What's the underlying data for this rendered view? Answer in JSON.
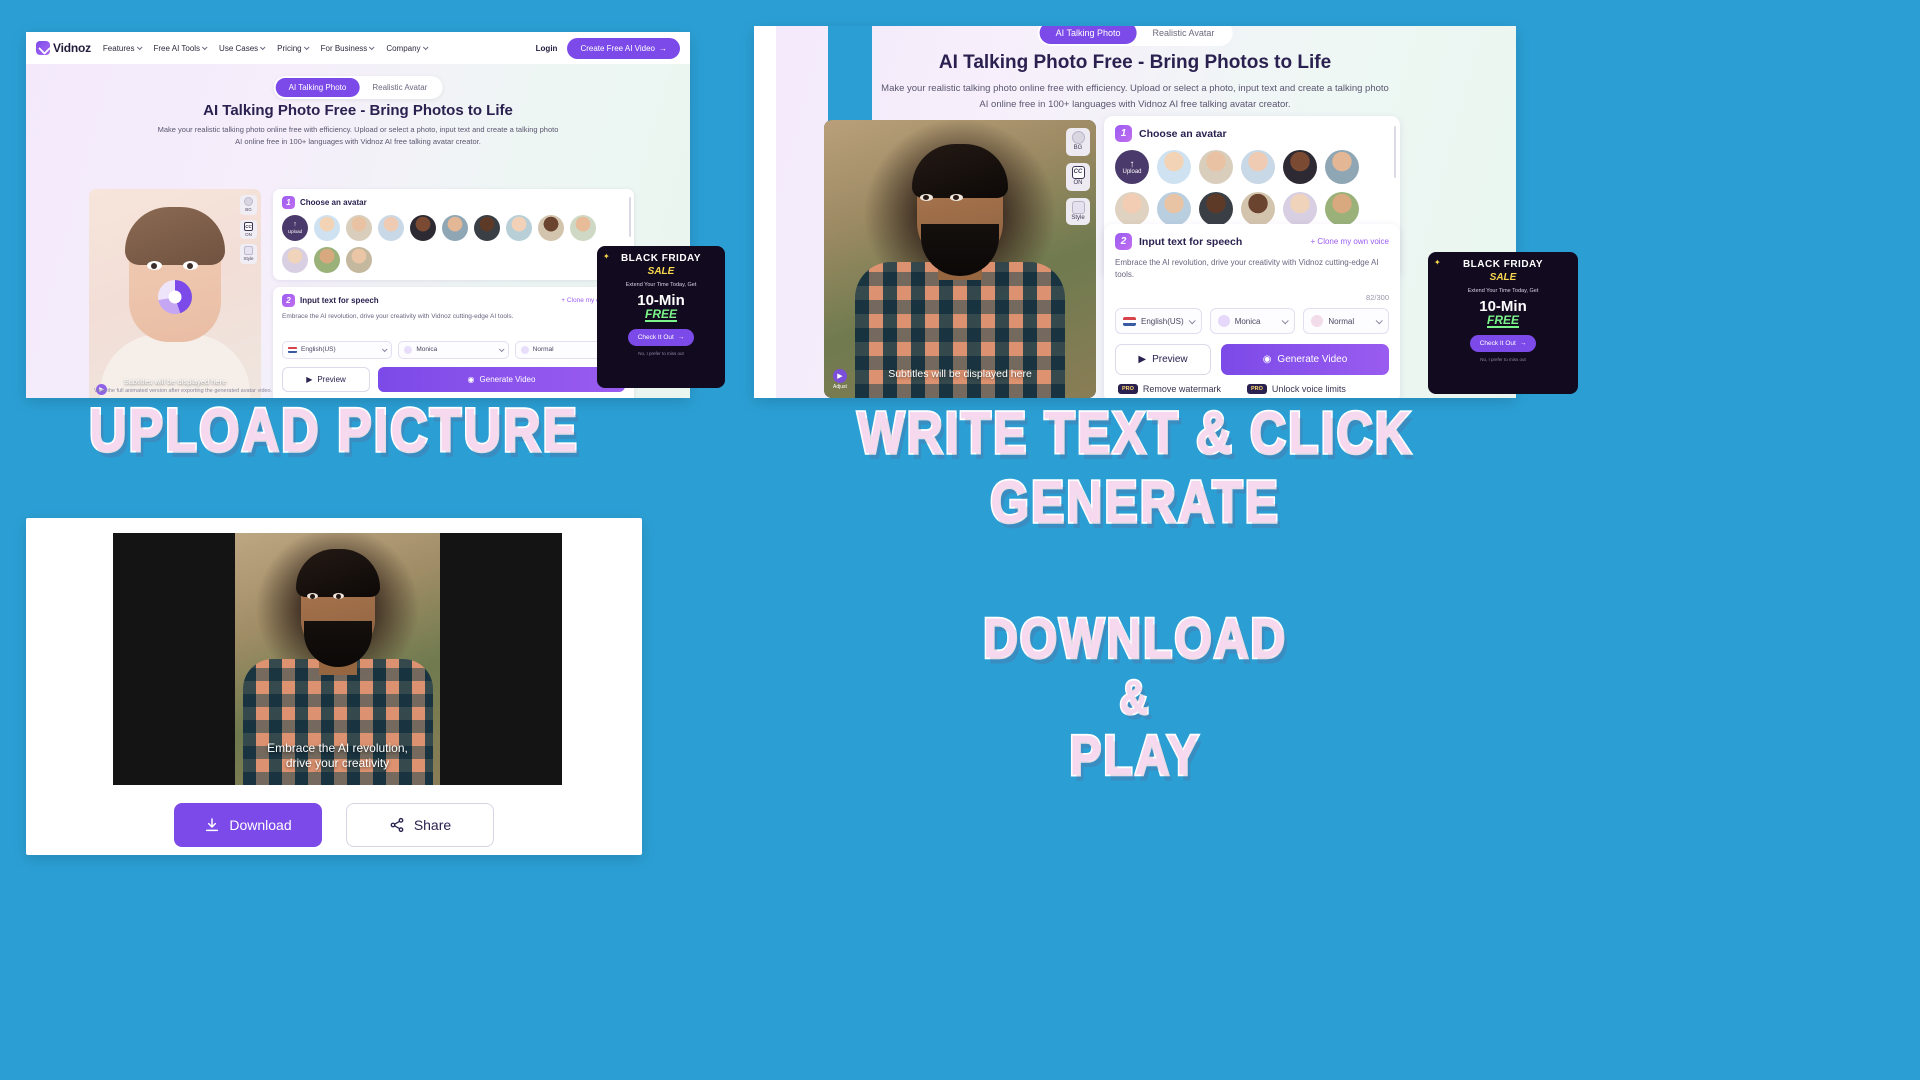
{
  "captions": {
    "step1": "Upload Picture",
    "step2_line1": "Write Text & Click",
    "step2_line2": "Generate",
    "step3_line1": "Download",
    "step3_line2": "&",
    "step3_line3": "Play"
  },
  "colors": {
    "background": "#2b9fd4",
    "caption_fill": "#f7d9ef",
    "caption_stroke": "#ffffff",
    "brand_purple": "#7c4ae8",
    "title_ink": "#2b2150",
    "promo_yellow": "#f8d64e",
    "promo_green": "#7bf58a"
  },
  "browser": {
    "logo": "Vidnoz",
    "nav_items": [
      {
        "label": "Features",
        "icon": "chevron-down-icon"
      },
      {
        "label": "Free AI Tools",
        "icon": "chevron-down-icon"
      },
      {
        "label": "Use Cases",
        "icon": "chevron-down-icon"
      },
      {
        "label": "Pricing",
        "icon": "chevron-down-icon"
      },
      {
        "label": "For Business",
        "icon": "chevron-down-icon"
      },
      {
        "label": "Company",
        "icon": "chevron-down-icon"
      }
    ],
    "login_label": "Login",
    "cta_label": "Create Free AI Video",
    "cta_arrow": "→"
  },
  "hero": {
    "tab_active": "AI Talking Photo",
    "tab_inactive": "Realistic Avatar",
    "title": "AI Talking Photo Free - Bring Photos to Life",
    "sub_line1": "Make your realistic talking photo online free with efficiency. Upload or select a photo, input text and create a talking photo",
    "sub_line2": "AI online free in 100+ languages with Vidnoz AI free talking avatar creator.",
    "footnote": "View the full animated version after exporting the generated avatar video."
  },
  "stage": {
    "subtitle_placeholder": "Subtitles will be displayed here",
    "play_label": "Adjust",
    "tools": [
      {
        "name": "bg-tool",
        "glyph": "",
        "label": "BG"
      },
      {
        "name": "caption-tool",
        "glyph": "CC",
        "label": "ON"
      },
      {
        "name": "style-tool",
        "glyph": "",
        "label": "Style"
      }
    ]
  },
  "step1": {
    "number": "1",
    "title": "Choose an avatar",
    "upload_label": "Upload",
    "upload_icon": "upload-arrow-icon",
    "avatar_count": 13
  },
  "step2": {
    "number": "2",
    "title": "Input text for speech",
    "clone_link": "+ Clone my own voice",
    "speech_text": "Embrace the AI revolution, drive your creativity with Vidnoz cutting-edge AI tools.",
    "counter": "82/300",
    "language": "English(US)",
    "voice": "Monica",
    "tone": "Normal",
    "preview_label": "Preview",
    "generate_label": "Generate Video",
    "preview_icon": "play-icon",
    "generate_icon": "sparkle-video-icon",
    "pro_items": [
      {
        "tag": "PRO",
        "label": "Remove watermark"
      },
      {
        "tag": "PRO",
        "label": "Unlock voice limits"
      }
    ]
  },
  "promo": {
    "heading_line1": "BLACK FRIDAY",
    "heading_line2": "SALE",
    "extend": "Extend Your Time Today, Get",
    "amount": "10-Min",
    "free": "FREE",
    "cta": "Check It Out",
    "cta_arrow": "→",
    "dismiss": "No, I prefer to miss out",
    "sparkle_icon": "sparkle-icon"
  },
  "result": {
    "caption_line1": "Embrace the AI revolution,",
    "caption_line2": "drive your creativity",
    "download_label": "Download",
    "share_label": "Share",
    "download_icon": "download-icon",
    "share_icon": "share-nodes-icon"
  }
}
